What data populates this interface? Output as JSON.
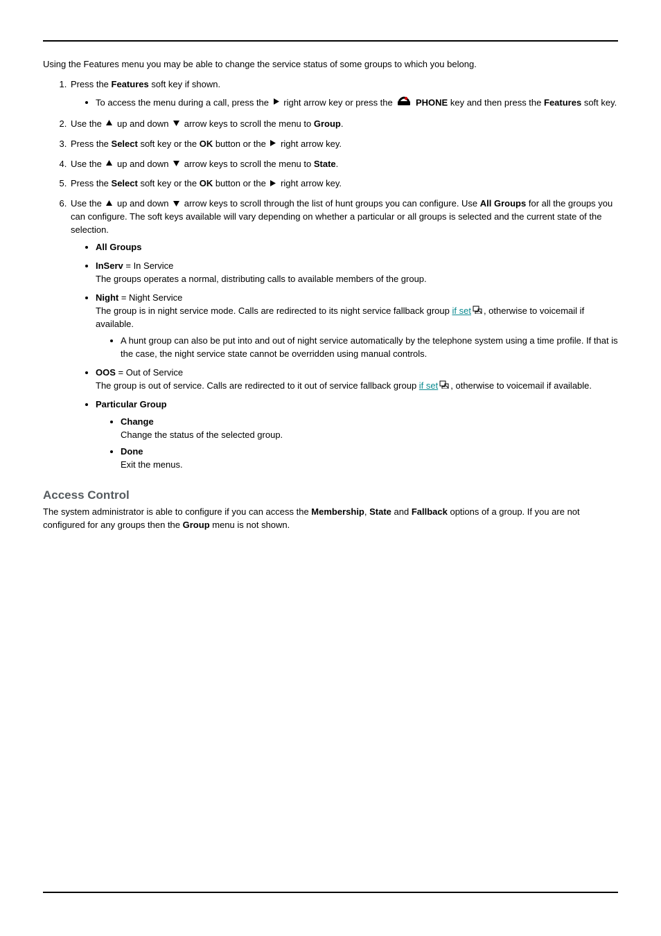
{
  "intro": "Using the Features menu you may be able to change the service status of some groups to which you belong.",
  "steps": {
    "s1": {
      "a": "Press the ",
      "b": "Features",
      "c": " soft key if shown."
    },
    "s1sub": {
      "a": "To access the menu during a call, press the ",
      "b": " right arrow key or press the ",
      "c": "PHONE",
      "d": " key and then press the ",
      "e": "Features",
      "f": " soft key."
    },
    "s2": {
      "a": "Use the ",
      "b": " up and down ",
      "c": " arrow keys to scroll the menu to ",
      "d": "Group",
      "e": "."
    },
    "s3": {
      "a": "Press the ",
      "b": "Select",
      "c": " soft key or the ",
      "d": "OK",
      "e": " button or the ",
      "f": " right arrow key."
    },
    "s4": {
      "a": "Use the ",
      "b": " up and down ",
      "c": " arrow keys to scroll the menu to ",
      "d": "State",
      "e": "."
    },
    "s5": {
      "a": "Press the ",
      "b": "Select",
      "c": " soft key or the ",
      "d": "OK",
      "e": " button or the ",
      "f": " right arrow key."
    },
    "s6": {
      "a": "Use the ",
      "b": " up and down ",
      "c": " arrow keys to scroll through the list of hunt groups you can configure. Use ",
      "d": "All Groups",
      "e": " for all the groups you can configure. The soft keys available will vary depending on whether a particular or all groups is selected and the current state of the selection."
    }
  },
  "bullets": {
    "allgroups": "All Groups",
    "inserv": {
      "a": "InServ",
      "b": " = In Service",
      "desc": "The groups operates a normal, distributing calls to available members of the group."
    },
    "night": {
      "a": "Night",
      "b": " = Night Service",
      "desc1": "The group is in night service mode. Calls are redirected to its night service fallback group ",
      "link": "if set",
      "desc2": ", otherwise to voicemail if available.",
      "sub": "A hunt group can also be put into and out of night service automatically by the telephone system using a time profile. If that is the case, the night service state cannot be overridden using manual controls."
    },
    "oos": {
      "a": "OOS",
      "b": " = Out of Service",
      "desc1": "The group is out of service. Calls are redirected to it out of service fallback group ",
      "link": "if set",
      "desc2": ", otherwise to voicemail if available."
    },
    "particular": "Particular Group",
    "change": {
      "a": "Change",
      "desc": "Change the status of the selected group."
    },
    "done": {
      "a": "Done",
      "desc": "Exit the menus."
    }
  },
  "access": {
    "heading": "Access Control",
    "p1a": "The system administrator is able to configure if you can access the ",
    "p1b": "Membership",
    "p1c": ", ",
    "p1d": "State",
    "p1e": " and ",
    "p1f": "Fallback",
    "p1g": " options of a group. If you are not configured for any groups then the ",
    "p1h": "Group",
    "p1i": " menu is not shown."
  }
}
